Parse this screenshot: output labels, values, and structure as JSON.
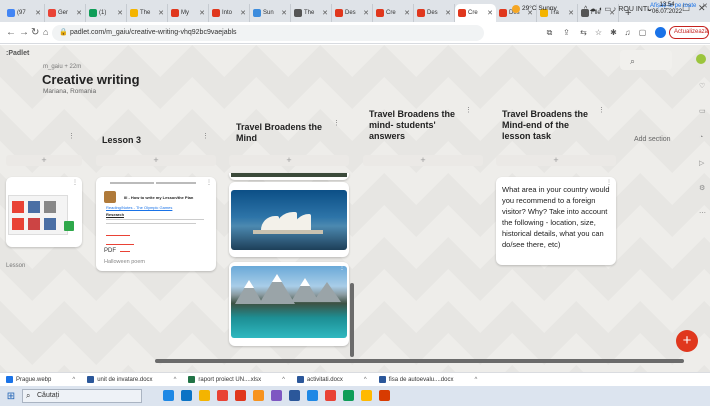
{
  "browser": {
    "tabs": [
      {
        "label": "(97",
        "color": "#4285f4"
      },
      {
        "label": "Ger",
        "color": "#e94235"
      },
      {
        "label": "(1)",
        "color": "#0f9d58"
      },
      {
        "label": "The",
        "color": "#f4b400"
      },
      {
        "label": "My",
        "color": "#e0371d"
      },
      {
        "label": "Into",
        "color": "#e0371d"
      },
      {
        "label": "Sun",
        "color": "#3c8cdd"
      },
      {
        "label": "The",
        "color": "#555555"
      },
      {
        "label": "Des",
        "color": "#e0371d"
      },
      {
        "label": "Cre",
        "color": "#e0371d"
      },
      {
        "label": "Des",
        "color": "#e0371d"
      },
      {
        "label": "Cre",
        "color": "#e0371d",
        "active": true
      },
      {
        "label": "Des",
        "color": "#e0371d"
      },
      {
        "label": "Tra",
        "color": "#f4b400"
      },
      {
        "label": "File",
        "color": "#555555"
      }
    ],
    "url": "padlet.com/m_gaiu/creative-writing-vhq92bc9vaejabls",
    "update_label": "Actualizează"
  },
  "board": {
    "brand": ":Padlet",
    "author": "m_gaiu + 22m",
    "title": "Creative writing",
    "subtitle": "Mariana, Romania",
    "add_section": "Add section",
    "columns": [
      {
        "title": ""
      },
      {
        "title": "Lesson 3"
      },
      {
        "title": "Travel Broadens the Mind"
      },
      {
        "title": "Travel Broadens the mind- students' answers"
      },
      {
        "title": "Travel Broadens the Mind-end of the lesson task"
      }
    ],
    "col0_card_caption": "Lesson",
    "lesson3_card": {
      "heading": "III - How to write my Lesson/the Plan",
      "line1": "Reading/Notes - The Olympic Games",
      "line2": "Research",
      "badge": "PDF",
      "caption": "Halloween poem"
    },
    "question_card": "What area in your country would you recommend to a foreign visitor? Why? Take into account the following - location, size, historical details, what you can do/see there, etc)"
  },
  "downloads": {
    "items": [
      {
        "name": "Prague.webp",
        "color": "#1a73e8"
      },
      {
        "name": "unit de invatare.docx",
        "color": "#2b579a"
      },
      {
        "name": "raport proiect UN....xlsx",
        "color": "#217346"
      },
      {
        "name": "activitati.docx",
        "color": "#2b579a"
      },
      {
        "name": "fisa de autoevalu....docx",
        "color": "#2b579a"
      }
    ],
    "show_all": "Afișați-le pe toate"
  },
  "taskbar": {
    "search_placeholder": "Căutați",
    "weather": "29°C Sunny",
    "tray_lang": "ROU INTL",
    "time": "13:54",
    "date": "06.07.2022",
    "apps": [
      "#1e88e5",
      "#0b73c5",
      "#f4b400",
      "#e94235",
      "#e0371d",
      "#f7931e",
      "#7e57c2",
      "#2b579a",
      "#1e88e5",
      "#e94235",
      "#0f9d58",
      "#ffb900",
      "#d83b01"
    ]
  }
}
